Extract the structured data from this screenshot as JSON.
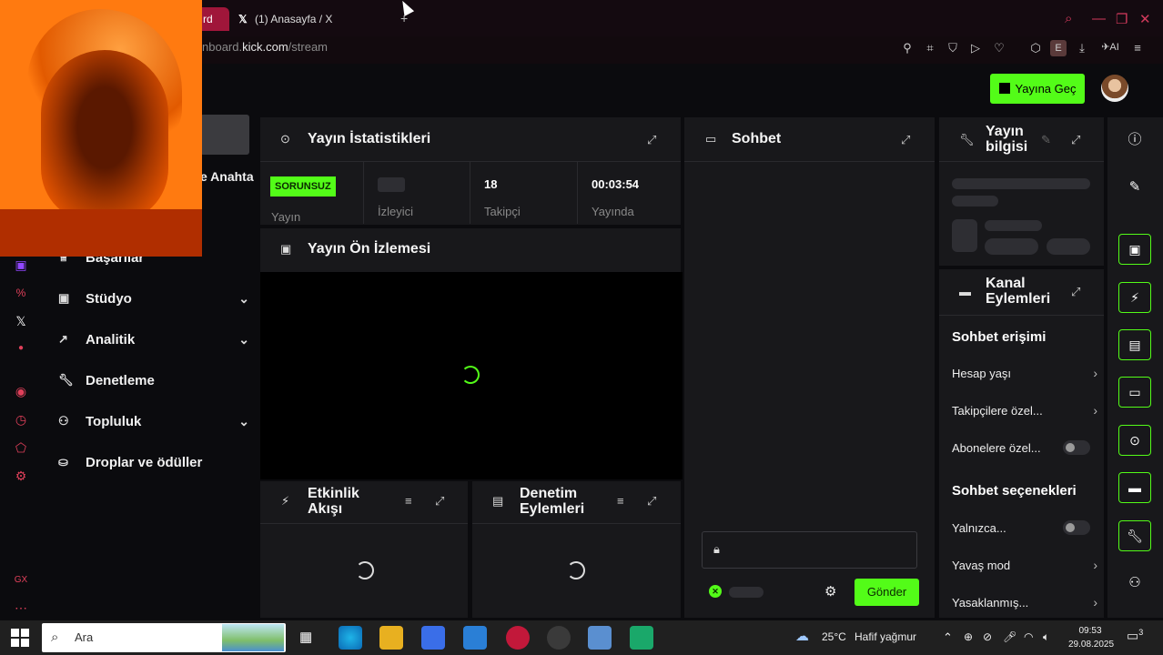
{
  "browser": {
    "tab_active_label": "rd",
    "tab2_label": "(1) Anasayfa / X",
    "tab2_icon": "x-logo-icon",
    "new_tab": "+",
    "url_prefix": "nboard.",
    "url_domain": "kick.com",
    "url_path": "/stream",
    "ext_ai": "AI",
    "ext_e": "E"
  },
  "header": {
    "go_live_label": "Yayına Geç"
  },
  "sidebar": {
    "partial_label": "e Anahta",
    "items": [
      {
        "label": "Başarılar",
        "icon": "trophy-icon",
        "chevron": false
      },
      {
        "label": "Stüdyo",
        "icon": "studio-icon",
        "chevron": true
      },
      {
        "label": "Analitik",
        "icon": "analytics-icon",
        "chevron": true
      },
      {
        "label": "Denetleme",
        "icon": "wrench-icon",
        "chevron": false
      },
      {
        "label": "Topluluk",
        "icon": "community-icon",
        "chevron": true
      },
      {
        "label": "Droplar ve ödüller",
        "icon": "gift-icon",
        "chevron": false
      }
    ]
  },
  "stats_panel": {
    "title": "Yayın İstatistikleri",
    "status_badge": "SORUNSUZ",
    "stats": [
      {
        "value": "",
        "label": "Yayın"
      },
      {
        "value": "",
        "label": "İzleyici"
      },
      {
        "value": "18",
        "label": "Takipçi"
      },
      {
        "value": "00:03:54",
        "label": "Yayında"
      }
    ]
  },
  "preview_panel": {
    "title": "Yayın Ön İzlemesi"
  },
  "activity_panel": {
    "title_line1": "Etkinlik",
    "title_line2": "Akışı"
  },
  "moderation_panel": {
    "title_line1": "Denetim",
    "title_line2": "Eylemleri"
  },
  "chat_panel": {
    "title": "Sohbet",
    "send_label": "Gönder"
  },
  "info_panel": {
    "title_line1": "Yayın",
    "title_line2": "bilgisi"
  },
  "channel_actions": {
    "title_line1": "Kanal",
    "title_line2": "Eylemleri",
    "chat_access_heading": "Sohbet erişimi",
    "access_options": [
      "Hesap yaşı",
      "Takipçilere özel...",
      "Abonelere özel..."
    ],
    "chat_options_heading": "Sohbet seçenekleri",
    "chat_options": [
      "Yalnızca...",
      "Yavaş mod",
      "Yasaklanmış..."
    ]
  },
  "taskbar": {
    "search_placeholder": "Ara",
    "weather_temp": "25°C",
    "weather_text": "Hafif yağmur",
    "time": "09:53",
    "date": "29.08.2025",
    "notif_count": "3"
  },
  "colors": {
    "accent": "#53fc18",
    "browser_accent": "#d23a5c"
  }
}
